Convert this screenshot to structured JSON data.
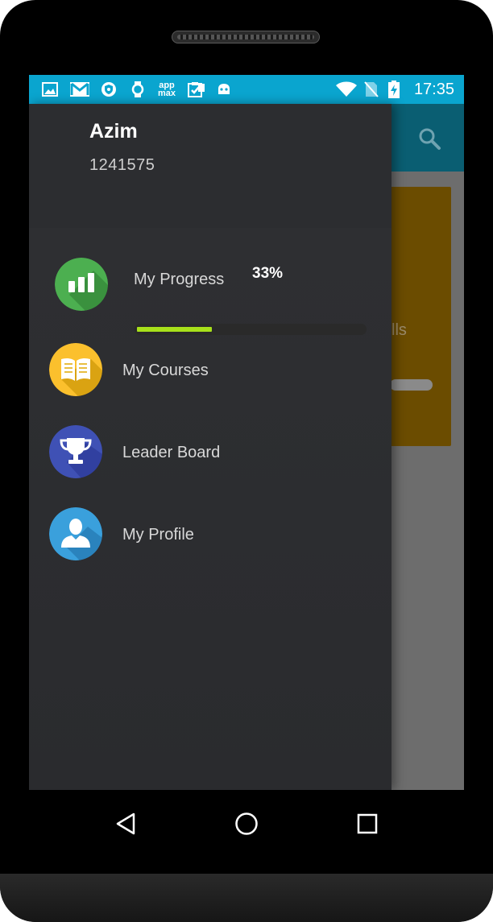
{
  "status_bar": {
    "time": "17:35",
    "notification_icons": [
      "gallery-icon",
      "gmail-icon",
      "vpn-shield-icon",
      "watch-icon",
      "appmax-icon",
      "clipboard-check-icon",
      "android-icon"
    ],
    "appmax_text": "app",
    "appmax_text2": "max",
    "system_icons": [
      "wifi-icon",
      "no-sim-icon",
      "battery-charging-icon"
    ]
  },
  "drawer": {
    "user_name": "Azim",
    "user_id": "1241575",
    "progress": {
      "label": "My Progress",
      "percent_text": "33%",
      "value": 0.33
    },
    "items": [
      {
        "label": "My Courses",
        "icon": "book-icon",
        "color": "#fbc02d"
      },
      {
        "label": "Leader Board",
        "icon": "trophy-icon",
        "color": "#3f51b5"
      },
      {
        "label": "My Profile",
        "icon": "person-icon",
        "color": "#3aa0dc"
      }
    ]
  },
  "background": {
    "card_text": "lls",
    "accent": "#0a5e72",
    "card_color": "#6b4c00"
  },
  "colors": {
    "status_bar": "#0aa5cf",
    "progress_green": "#4caf50",
    "progress_fill": "#a7e01a"
  },
  "navigation": [
    "back-icon",
    "home-icon",
    "recents-icon"
  ]
}
